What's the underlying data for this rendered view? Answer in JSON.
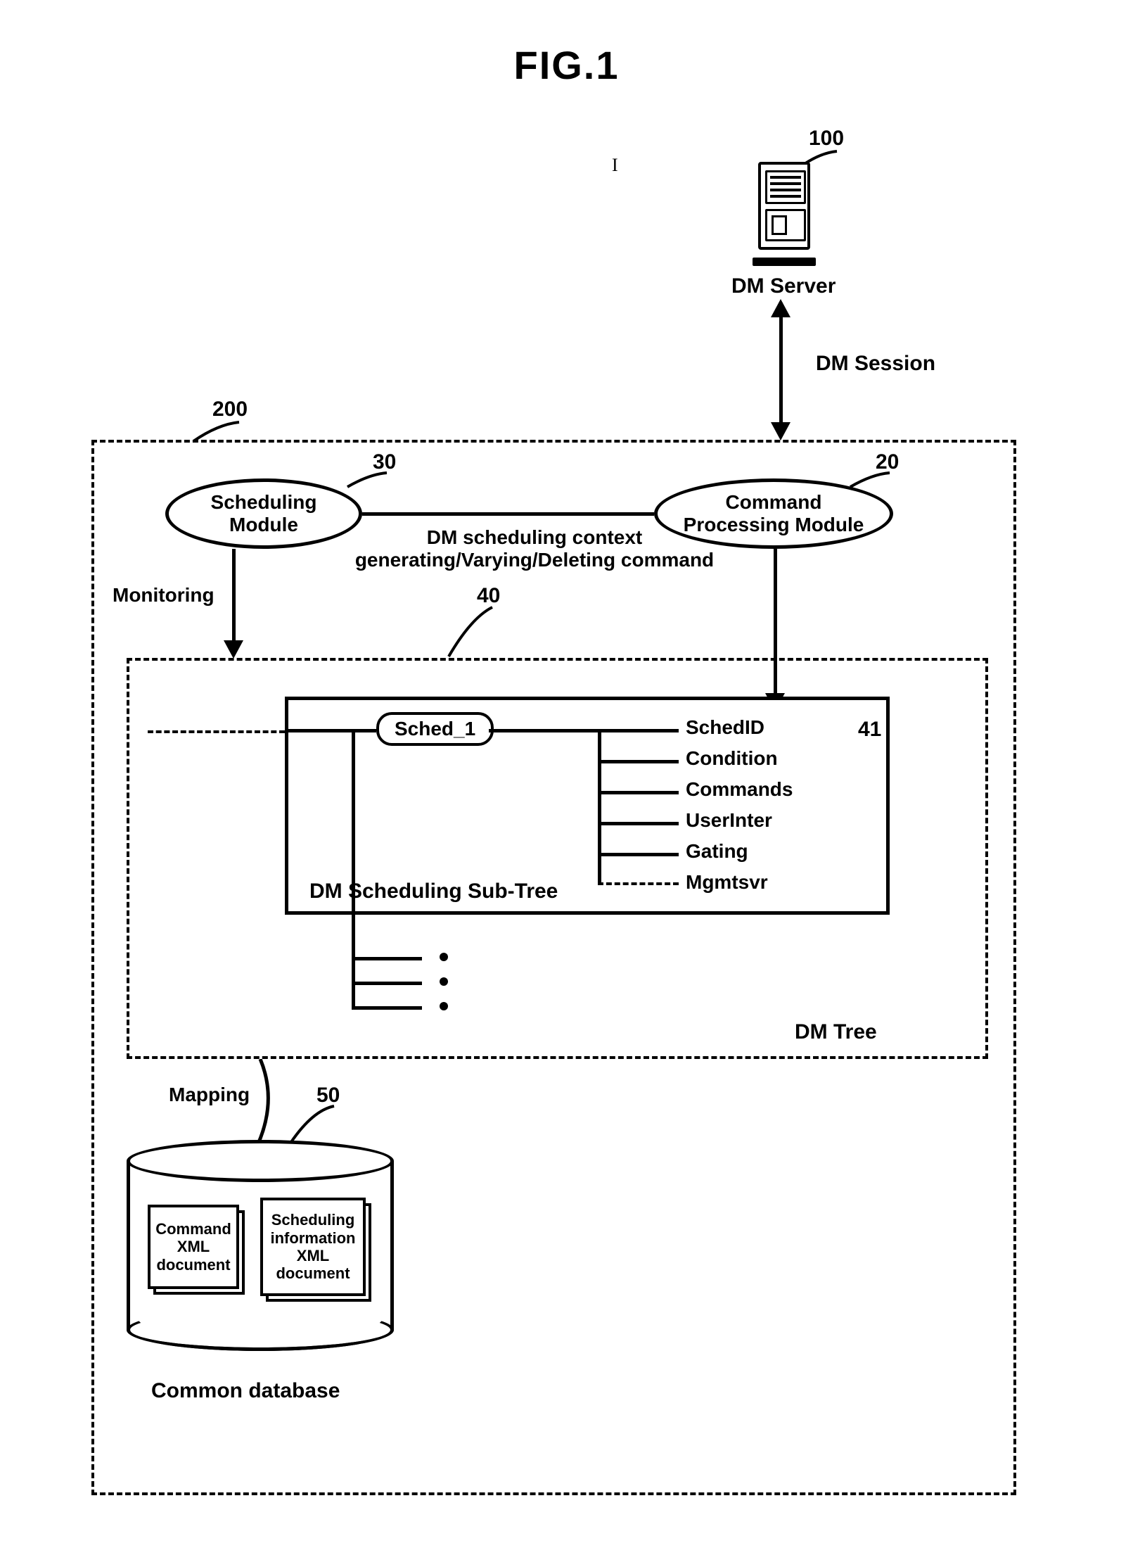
{
  "figure": {
    "title": "FIG.1"
  },
  "refs": {
    "server": "100",
    "client": "200",
    "sched_module": "30",
    "cmd_module": "20",
    "dm_tree": "40",
    "subtree": "41",
    "db": "50"
  },
  "server": {
    "label": "DM Server"
  },
  "session": {
    "label": "DM Session"
  },
  "modules": {
    "scheduling": "Scheduling\nModule",
    "command": "Command\nProcessing Module"
  },
  "edge_labels": {
    "ctx_cmd_l1": "DM scheduling context",
    "ctx_cmd_l2": "generating/Varying/Deleting command",
    "monitoring": "Monitoring",
    "mapping": "Mapping"
  },
  "tree": {
    "node": "Sched_1",
    "subtree_label": "DM Scheduling Sub-Tree",
    "root_label": "DM Tree",
    "attrs": [
      "SchedID",
      "Condition",
      "Commands",
      "UserInter",
      "Gating",
      "Mgmtsvr"
    ]
  },
  "db": {
    "label": "Common database",
    "doc1": "Command\nXML\ndocument",
    "doc2": "Scheduling\ninformation\nXML\ndocument"
  }
}
